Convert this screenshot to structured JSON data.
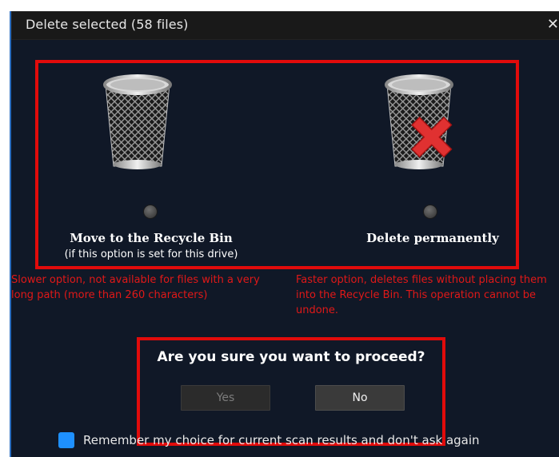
{
  "dialog": {
    "title": "Delete selected (58 files)",
    "close_glyph": "✕"
  },
  "options": [
    {
      "label": "Move to the Recycle Bin",
      "sublabel": "(if this option is set for this drive)",
      "icon": "recycle-bin-icon",
      "note": "Slower option, not available for files with a very long path (more than 260 characters)"
    },
    {
      "label": "Delete permanently",
      "icon": "recycle-bin-delete-icon",
      "note": "Faster option, deletes files without placing them into the Recycle Bin. This operation cannot be undone."
    }
  ],
  "confirm": {
    "question": "Are you sure you want to proceed?",
    "yes_label": "Yes",
    "no_label": "No"
  },
  "remember": {
    "label": "Remember my choice for current scan results and don't ask again",
    "checked": false
  },
  "colors": {
    "highlight_red": "#e10b0b",
    "note_red": "#e01818",
    "checkbox_blue": "#1e90ff",
    "dialog_bg": "#101827"
  }
}
